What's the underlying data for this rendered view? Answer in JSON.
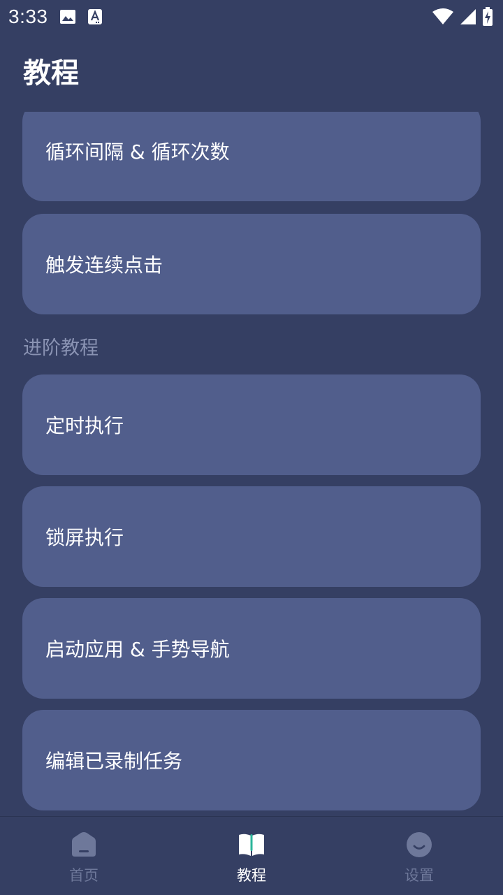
{
  "status_bar": {
    "time": "3:33",
    "icons_left": [
      "image-icon",
      "font-a-icon"
    ],
    "icons_right": [
      "wifi-icon",
      "cellular-signal-icon",
      "battery-charging-icon"
    ]
  },
  "header": {
    "title": "教程"
  },
  "cards_top": [
    {
      "label": "循环间隔 & 循环次数"
    },
    {
      "label": "触发连续点击"
    }
  ],
  "section": {
    "label": "进阶教程"
  },
  "cards_advanced": [
    {
      "label": "定时执行"
    },
    {
      "label": "锁屏执行"
    },
    {
      "label": "启动应用 & 手势导航"
    },
    {
      "label": "编辑已录制任务"
    }
  ],
  "bottom_nav": {
    "items": [
      {
        "label": "首页",
        "icon": "home-icon",
        "active": false
      },
      {
        "label": "教程",
        "icon": "book-icon",
        "active": true
      },
      {
        "label": "设置",
        "icon": "smile-icon",
        "active": false
      }
    ]
  },
  "colors": {
    "background": "#353f63",
    "card": "#515e8c",
    "section_label": "#8a93b3",
    "nav_inactive": "#6e789a",
    "accent": "#2bb59a"
  }
}
